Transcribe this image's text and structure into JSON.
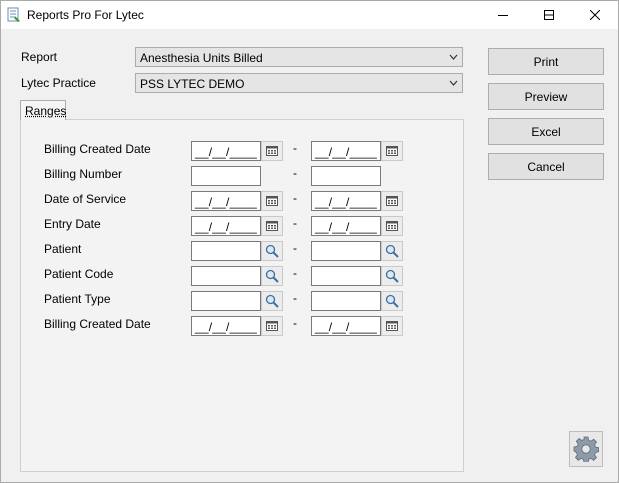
{
  "window": {
    "title": "Reports Pro For Lytec",
    "icon": "report-app-icon"
  },
  "form": {
    "report_label": "Report",
    "report_value": "Anesthesia Units Billed",
    "practice_label": "Lytec Practice",
    "practice_value": "PSS LYTEC DEMO"
  },
  "tabs": [
    {
      "label": "Ranges",
      "selected": true
    }
  ],
  "ranges": {
    "separator": "-",
    "date_mask": "__/__/____",
    "rows": [
      {
        "label": "Billing Created Date",
        "from": "__/__/____",
        "to": "__/__/____",
        "picker": "calendar-icon"
      },
      {
        "label": "Billing Number",
        "from": "",
        "to": "",
        "picker": "none"
      },
      {
        "label": "Date of Service",
        "from": "__/__/____",
        "to": "__/__/____",
        "picker": "calendar-icon"
      },
      {
        "label": "Entry Date",
        "from": "__/__/____",
        "to": "__/__/____",
        "picker": "calendar-icon"
      },
      {
        "label": "Patient",
        "from": "",
        "to": "",
        "picker": "magnifier-icon"
      },
      {
        "label": "Patient Code",
        "from": "",
        "to": "",
        "picker": "magnifier-icon"
      },
      {
        "label": "Patient Type",
        "from": "",
        "to": "",
        "picker": "magnifier-icon"
      },
      {
        "label": "Billing Created Date",
        "from": "__/__/____",
        "to": "__/__/____",
        "picker": "calendar-icon"
      }
    ]
  },
  "actions": {
    "print": "Print",
    "preview": "Preview",
    "excel": "Excel",
    "cancel": "Cancel"
  },
  "settings_icon": "gear-icon",
  "colors": {
    "title_bg": "#ffffff",
    "window_bg": "#f0f0f0",
    "button_bg": "#e1e1e1"
  }
}
